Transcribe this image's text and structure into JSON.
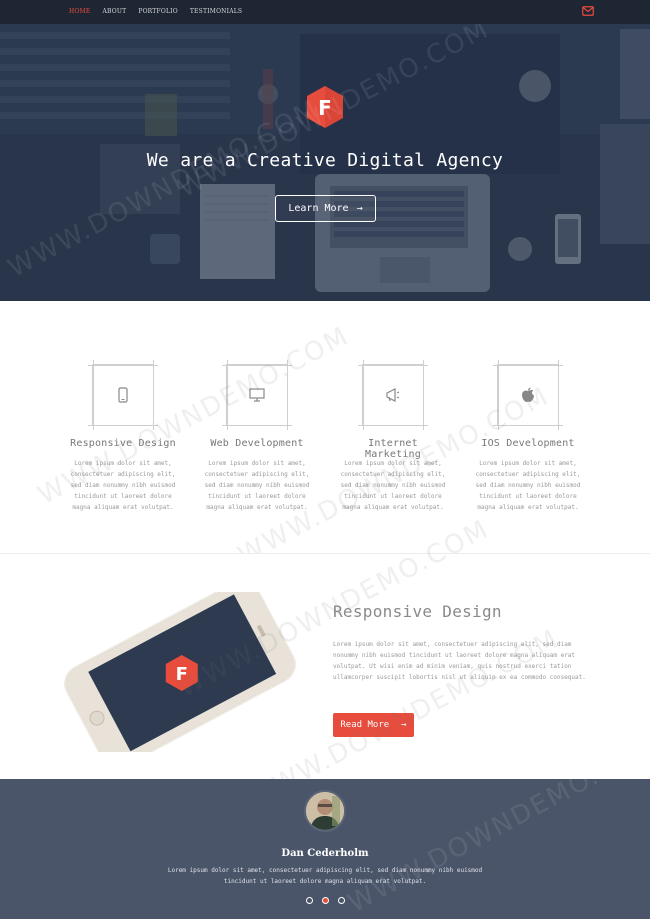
{
  "nav": {
    "links": [
      "HOME",
      "ABOUT",
      "PORTFOLIO",
      "TESTIMONIALS"
    ],
    "active_index": 0
  },
  "hero": {
    "logo_letter": "F",
    "title": "We are a Creative Digital Agency",
    "button_label": "Learn More"
  },
  "services": [
    {
      "icon": "mobile-phone-icon",
      "title": "Responsive Design",
      "desc": "Lorem ipsum dolor sit amet, consectetuer adipiscing elit, sed diam nonummy nibh euismod tincidunt ut laoreet dolore magna aliquam erat volutpat."
    },
    {
      "icon": "monitor-icon",
      "title": "Web Development",
      "desc": "Lorem ipsum dolor sit amet, consectetuer adipiscing elit, sed diam nonummy nibh euismod tincidunt ut laoreet dolore magna aliquam erat volutpat."
    },
    {
      "icon": "megaphone-icon",
      "title": "Internet Marketing",
      "desc": "Lorem ipsum dolor sit amet, consectetuer adipiscing elit, sed diam nonummy nibh euismod tincidunt ut laoreet dolore magna aliquam erat volutpat."
    },
    {
      "icon": "apple-icon",
      "title": "IOS Development",
      "desc": "Lorem ipsum dolor sit amet, consectetuer adipiscing elit, sed diam nonummy nibh euismod tincidunt ut laoreet dolore magna aliquam erat volutpat."
    }
  ],
  "feature": {
    "title": "Responsive Design",
    "desc": "Lorem ipsum dolor sit amet, consectetuer adipiscing elit, sed diam nonummy nibh euismod tincidunt ut laoreet dolore magna aliquam erat volutpat. Ut wisi enim ad minim veniam, quis nostrud exerci tation ullamcorper suscipit lobortis nisl ut aliquip ex ea commodo consequat.",
    "button_label": "Read More",
    "logo_letter": "F"
  },
  "testimonial": {
    "name": "Dan Cederholm",
    "text": "Lorem ipsum dolor sit amet, consectetuer adipiscing elit, sed diam nonummy nibh euismod tincidunt ut laoreet dolore magna aliquam erat volutpat.",
    "dots": 3,
    "active_dot": 1
  },
  "watermark": "WWW.DOWNDEMO.COM",
  "colors": {
    "accent": "#e74c3c",
    "nav_bg": "#1f2633",
    "testimonial_bg": "#4a5569"
  }
}
